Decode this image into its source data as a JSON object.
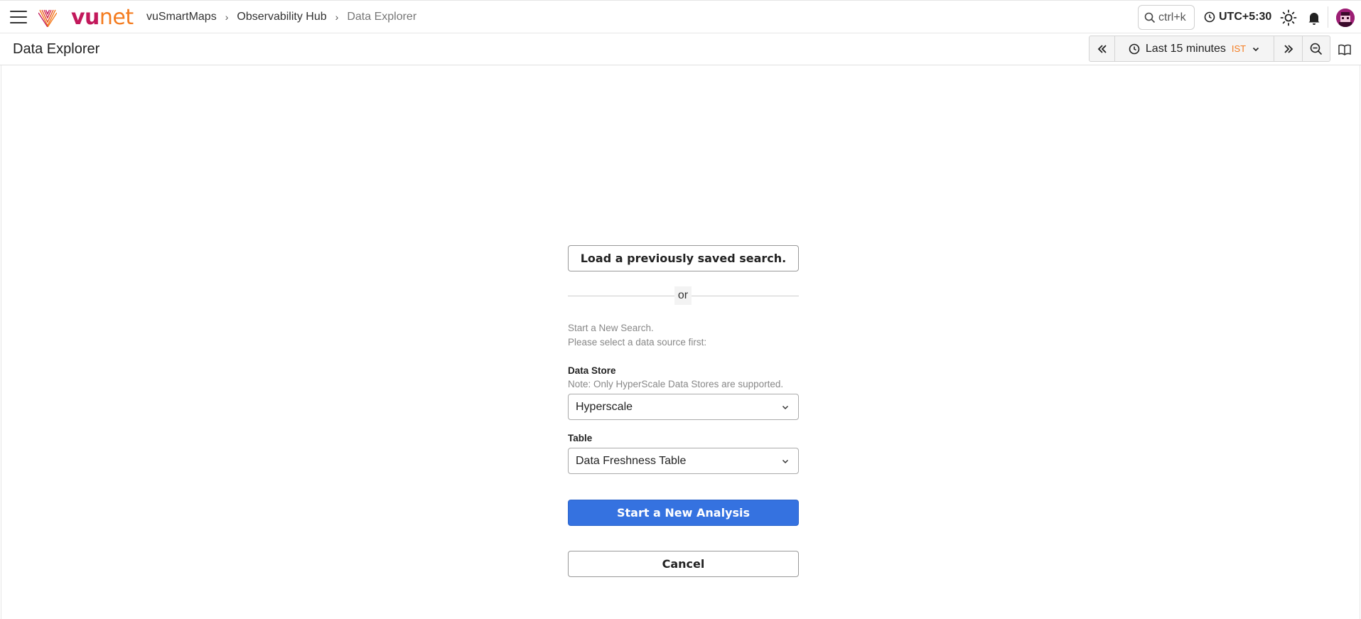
{
  "header": {
    "logo_text_a": "vu",
    "logo_text_b": "net",
    "breadcrumb": [
      "vuSmartMaps",
      "Observability Hub",
      "Data Explorer"
    ],
    "search_shortcut": "ctrl+k",
    "timezone": "UTC+5:30"
  },
  "subheader": {
    "page_title": "Data Explorer",
    "time_range_label": "Last 15 minutes",
    "time_zone_badge": "IST"
  },
  "form": {
    "load_saved_label": "Load a previously saved search.",
    "or_label": "or",
    "hint_line1": "Start a New Search.",
    "hint_line2": "Please select a data source first:",
    "data_store_label": "Data Store",
    "data_store_note": "Note: Only HyperScale Data Stores are supported.",
    "data_store_value": "Hyperscale",
    "table_label": "Table",
    "table_value": "Data Freshness Table",
    "start_label": "Start a New Analysis",
    "cancel_label": "Cancel"
  },
  "colors": {
    "brand_magenta": "#c2185b",
    "brand_orange": "#f47c20",
    "primary_blue": "#3572e0"
  },
  "icons": [
    "hamburger-icon",
    "vunet-logo-icon",
    "search-icon",
    "clock-icon",
    "sun-icon",
    "bell-icon",
    "avatar",
    "chevron-double-left-icon",
    "chevron-down-icon",
    "chevron-double-right-icon",
    "zoom-out-icon",
    "book-icon"
  ]
}
